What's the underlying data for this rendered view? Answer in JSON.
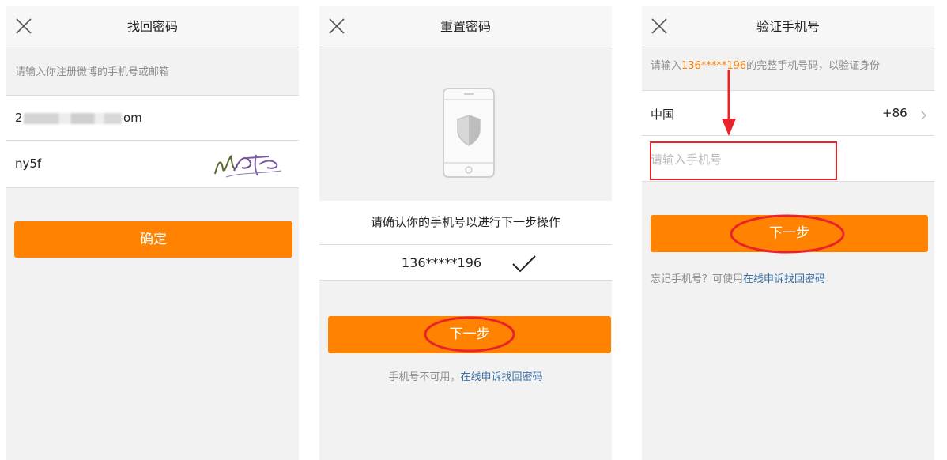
{
  "panel1": {
    "title": "找回密码",
    "instruction": "请输入你注册微博的手机号或邮箱",
    "account_prefix": "2",
    "account_suffix": "om",
    "captcha_input": "ny5f",
    "confirm_label": "确定"
  },
  "panel2": {
    "title": "重置密码",
    "prompt": "请确认你的手机号以进行下一步操作",
    "masked_phone": "136*****196",
    "next_label": "下一步",
    "unavailable_text": "手机号不可用，",
    "appeal_link": "在线申诉找回密码"
  },
  "panel3": {
    "title": "验证手机号",
    "hint_before": "请输入",
    "hint_phone": "136*****196",
    "hint_after": "的完整手机号码，以验证身份",
    "country": "中国",
    "country_code": "+86",
    "phone_placeholder": "请输入手机号",
    "next_label": "下一步",
    "forgot_text": "忘记手机号？可使用",
    "appeal_link": "在线申诉找回密码"
  },
  "colors": {
    "accent": "#ff8200",
    "link": "#3a6ea5",
    "annotation": "#e8242a"
  },
  "icons": [
    "close-icon",
    "phone-shield-icon",
    "check-icon",
    "chevron-right-icon",
    "down-arrow-icon"
  ]
}
